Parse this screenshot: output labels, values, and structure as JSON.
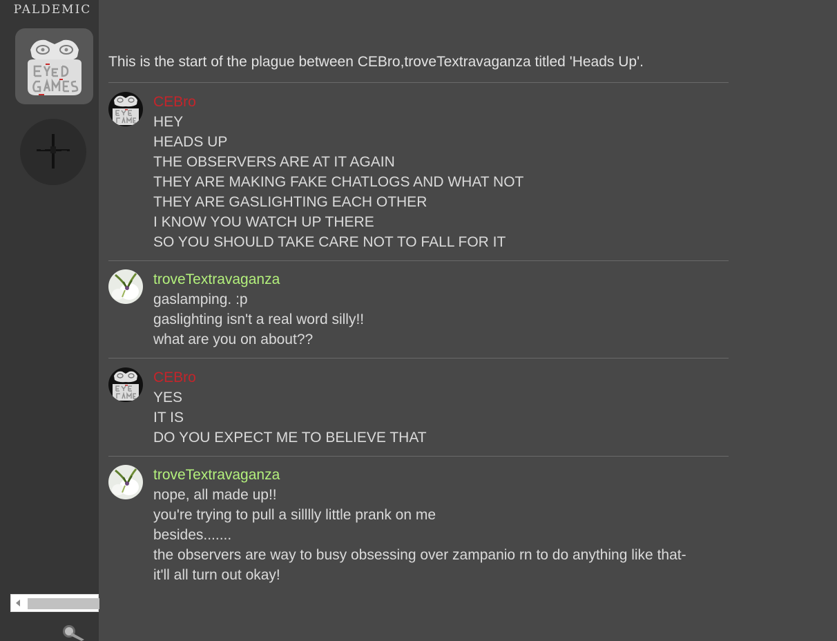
{
  "sidebar": {
    "brand": "PALDEMIC",
    "server_icon": "eye-dol-games-logo",
    "add_icon": "plus-icon",
    "bottom_icon": "flashlight-icon"
  },
  "intro": "This is the start of the plague between CEBro,troveTextravaganza titled 'Heads Up'.",
  "colors": {
    "background": "#484848",
    "sidebar": "#363636",
    "cebro_name": "#c4252b",
    "trove_name": "#b3f07c",
    "text": "#dadada"
  },
  "messages": [
    {
      "author": "CEBro",
      "lines": [
        "HEY",
        "HEADS UP",
        "THE OBSERVERS ARE AT IT AGAIN",
        "THEY ARE MAKING FAKE CHATLOGS AND WHAT NOT",
        "THEY ARE GASLIGHTING EACH OTHER",
        "I KNOW YOU WATCH UP THERE",
        "SO YOU SHOULD TAKE CARE NOT TO FALL FOR IT"
      ]
    },
    {
      "author": "troveTextravaganza",
      "lines": [
        "gaslamping. :p",
        "gaslighting isn't a real word silly!!",
        "what are you on about??"
      ]
    },
    {
      "author": "CEBro",
      "lines": [
        "YES",
        "IT IS",
        "DO YOU EXPECT ME TO BELIEVE THAT"
      ]
    },
    {
      "author": "troveTextravaganza",
      "lines": [
        "nope, all made up!!",
        "you're trying to pull a silllly little prank on me",
        "besides.......",
        "the observers are way to busy obsessing over zampanio rn to do anything like that-",
        "it'll all turn out okay!"
      ]
    }
  ]
}
